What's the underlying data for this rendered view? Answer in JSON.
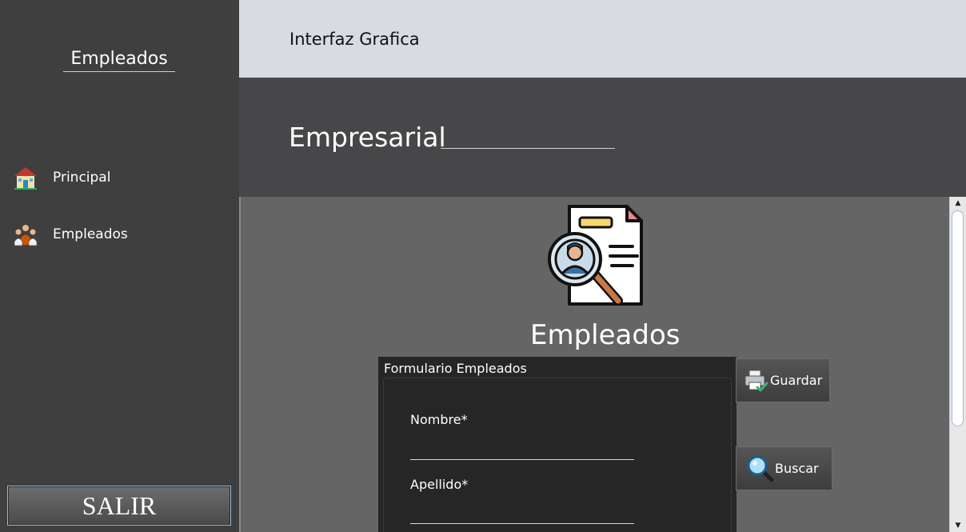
{
  "sidebar": {
    "title": "Empleados",
    "items": [
      {
        "label": "Principal",
        "icon": "house-icon"
      },
      {
        "label": "Empleados",
        "icon": "people-icon"
      }
    ],
    "exit_label": "SALIR"
  },
  "header": {
    "title": "Interfaz Grafica",
    "subtitle": "Empresarial"
  },
  "main": {
    "heading": "Empleados",
    "hero_icon": "employee-search-document-icon",
    "form": {
      "title": "Formulario Empleados",
      "fields": [
        {
          "label": "Nombre*",
          "value": ""
        },
        {
          "label": "Apellido*",
          "value": ""
        }
      ]
    },
    "buttons": {
      "save_label": "Guardar",
      "search_label": "Buscar"
    }
  },
  "colors": {
    "sidebar_bg": "#3f3f3f",
    "topbar_bg": "#d9dbe2",
    "subheader_bg": "#474749",
    "content_bg": "#656565",
    "form_bg": "#262626"
  }
}
